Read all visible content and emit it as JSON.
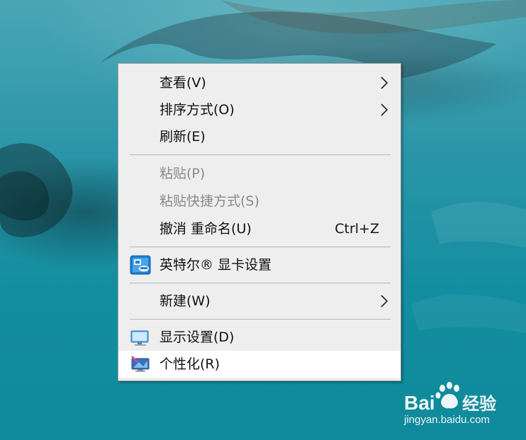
{
  "menu": {
    "items": [
      {
        "label": "查看(V)",
        "has_submenu": true,
        "enabled": true
      },
      {
        "label": "排序方式(O)",
        "has_submenu": true,
        "enabled": true
      },
      {
        "label": "刷新(E)",
        "has_submenu": false,
        "enabled": true
      },
      {
        "label": "粘贴(P)",
        "has_submenu": false,
        "enabled": false
      },
      {
        "label": "粘贴快捷方式(S)",
        "has_submenu": false,
        "enabled": false
      },
      {
        "label": "撤消 重命名(U)",
        "shortcut": "Ctrl+Z",
        "has_submenu": false,
        "enabled": true
      },
      {
        "label": "英特尔® 显卡设置",
        "icon": "intel-graphics-icon",
        "has_submenu": false,
        "enabled": true
      },
      {
        "label": "新建(W)",
        "has_submenu": true,
        "enabled": true
      },
      {
        "label": "显示设置(D)",
        "icon": "display-settings-icon",
        "has_submenu": false,
        "enabled": true
      },
      {
        "label": "个性化(R)",
        "icon": "personalize-icon",
        "has_submenu": false,
        "enabled": true,
        "highlighted": true
      }
    ]
  },
  "watermark": {
    "brand": "Bai经验",
    "site": "jingyan.baidu.com"
  },
  "colors": {
    "menu_bg": "#eeeeee",
    "highlight_bg": "#ffffff",
    "disabled_text": "#8a8a8a",
    "desktop_water": "#138ea0"
  }
}
